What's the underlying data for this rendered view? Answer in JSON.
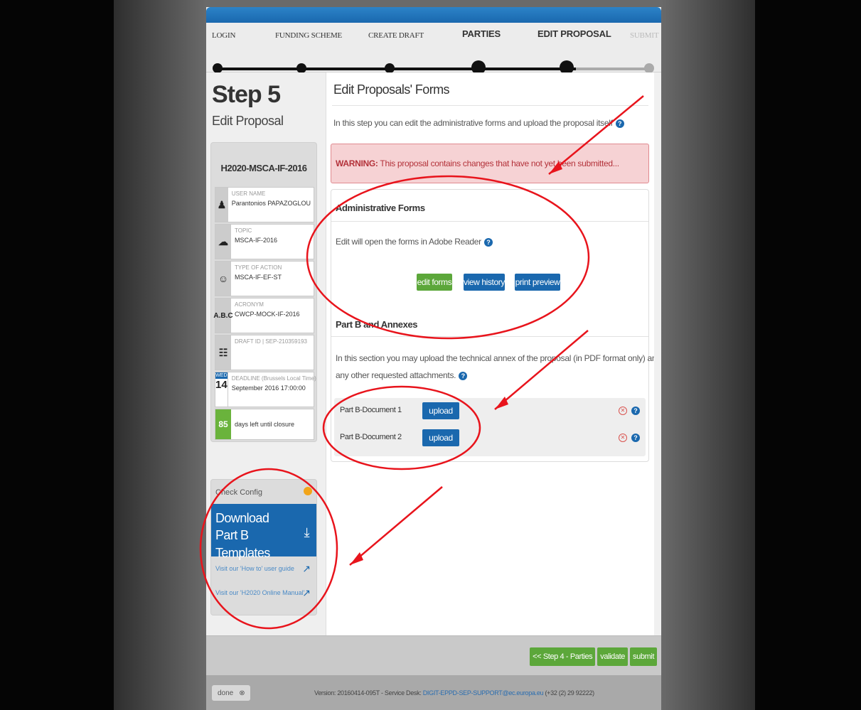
{
  "wizard": {
    "steps": [
      "LOGIN",
      "FUNDING SCHEME",
      "CREATE DRAFT",
      "PARTIES",
      "EDIT PROPOSAL",
      "SUBMIT"
    ]
  },
  "left": {
    "step_title": "Step 5",
    "step_subtitle": "Edit Proposal",
    "call_id": "H2020-MSCA-IF-2016",
    "user_label": "USER NAME",
    "user_value": "Parantonios PAPAZOGLOU",
    "topic_label": "TOPIC",
    "topic_value": "MSCA-IF-2016",
    "action_label": "TYPE OF ACTION",
    "action_value": "MSCA-IF-EF-ST",
    "acronym_label": "ACRONYM",
    "acronym_value": "CWCP-MOCK-IF-2016",
    "draft_label": "DRAFT ID | SEP-210359193",
    "deadline_day_name": "WED",
    "deadline_day": "14",
    "deadline_label": "DEADLINE (Brussels Local Time)",
    "deadline_value": "September 2016 17:00:00",
    "days_left": "85",
    "days_left_text": "days left until closure",
    "abc_icon": "A.B.C",
    "check_config": "Check Config",
    "download_label": "Download Part B Templates",
    "howto_link": "Visit our 'How to' user guide",
    "manual_link": "Visit our 'H2020 Online Manual'"
  },
  "main": {
    "title": "Edit Proposals' Forms",
    "intro": "In this step you can edit the administrative forms and upload the proposal itself",
    "warning_label": "WARNING:",
    "warning_text": " This proposal contains changes that have not yet been submitted...",
    "admin_title": "Administrative Forms",
    "admin_text": "Edit will open the forms in Adobe Reader",
    "edit_forms": "edit forms",
    "view_history": "view history",
    "print_preview": "print preview",
    "partb_title": "Part B and Annexes",
    "partb_text_1": "In this section you may upload the technical annex of the proposal (in PDF format only) and",
    "partb_text_2": "any other requested attachments.",
    "docs": [
      {
        "label": "Part B-Document 1",
        "button": "upload"
      },
      {
        "label": "Part B-Document 2",
        "button": "upload"
      }
    ]
  },
  "footer": {
    "back": "<< Step 4 - Parties",
    "validate": "validate",
    "submit": "submit",
    "done": "done",
    "version": "Version: 20160414-095T - Service Desk: ",
    "email": "DIGIT-EPPD-SEP-SUPPORT@ec.europa.eu",
    "phone": " (+32 (2) 29 92222)"
  },
  "colors": {
    "primary_blue": "#1a68ae",
    "green": "#5ca73a",
    "warning_bg": "#f6d2d4",
    "annotation_red": "#e8141c"
  }
}
